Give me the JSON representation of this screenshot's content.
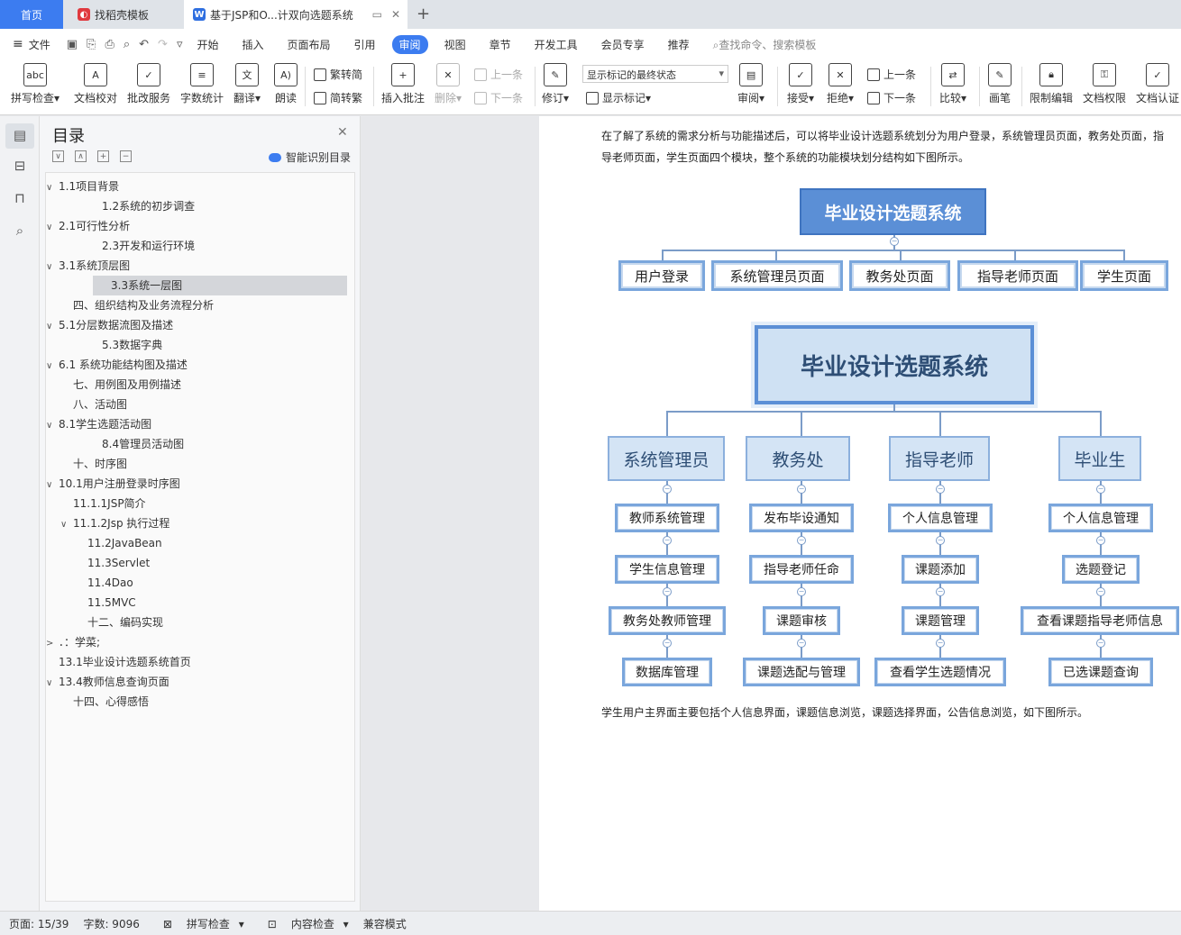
{
  "tabs": {
    "home": "首页",
    "template": "找稻壳模板",
    "doc": "基于JSP和O...计双向选题系统",
    "add": "+"
  },
  "menu": {
    "file": "文件",
    "items": [
      "开始",
      "插入",
      "页面布局",
      "引用",
      "审阅",
      "视图",
      "章节",
      "开发工具",
      "会员专享",
      "推荐"
    ],
    "active": "审阅",
    "search": "查找命令、搜索模板"
  },
  "ribbon": {
    "spell": "拼写检查",
    "proof": "文档校对",
    "revise_service": "批改服务",
    "wordcount": "字数统计",
    "translate": "翻译",
    "read": "朗读",
    "to_trad": "繁转简",
    "to_simp": "简转繁",
    "insert_comment": "插入批注",
    "delete": "删除",
    "prev": "上一条",
    "next": "下一条",
    "track": "修订",
    "markup_state": "显示标记的最终状态",
    "show_markup": "显示标记",
    "review": "审阅",
    "accept": "接受",
    "reject": "拒绝",
    "prev2": "上一条",
    "next2": "下一条",
    "compare": "比较",
    "pen": "画笔",
    "restrict": "限制编辑",
    "permission": "文档权限",
    "certify": "文档认证"
  },
  "toc": {
    "title": "目录",
    "smart": "智能识别目录",
    "items": [
      {
        "label": "1.1项目背景",
        "arrow": "∨"
      },
      {
        "label": "1.2系统的初步调查",
        "arrow": ""
      },
      {
        "label": "2.1可行性分析",
        "arrow": "∨"
      },
      {
        "label": "2.3开发和运行环境",
        "arrow": ""
      },
      {
        "label": "3.1系统顶层图",
        "arrow": "∨"
      },
      {
        "label": "3.3系统一层图",
        "arrow": ""
      },
      {
        "label": "四、组织结构及业务流程分析",
        "arrow": ""
      },
      {
        "label": "5.1分层数据流图及描述",
        "arrow": "∨"
      },
      {
        "label": "5.3数据字典",
        "arrow": ""
      },
      {
        "label": "6.1 系统功能结构图及描述",
        "arrow": "∨"
      },
      {
        "label": "七、用例图及用例描述",
        "arrow": ""
      },
      {
        "label": "八、活动图",
        "arrow": ""
      },
      {
        "label": "8.1学生选题活动图",
        "arrow": "∨"
      },
      {
        "label": "8.4管理员活动图",
        "arrow": ""
      },
      {
        "label": "十、时序图",
        "arrow": ""
      },
      {
        "label": "10.1用户注册登录时序图",
        "arrow": "∨"
      },
      {
        "label": "11.1.1JSP简介",
        "arrow": ""
      },
      {
        "label": "11.1.2Jsp 执行过程",
        "arrow": "∨"
      },
      {
        "label": "11.2JavaBean",
        "arrow": ""
      },
      {
        "label": "11.3Servlet",
        "arrow": ""
      },
      {
        "label": "11.4Dao",
        "arrow": ""
      },
      {
        "label": "11.5MVC",
        "arrow": ""
      },
      {
        "label": "十二、编码实现",
        "arrow": ""
      },
      {
        "label": "．：学菜;",
        "arrow": ">"
      },
      {
        "label": "13.1毕业设计选题系统首页",
        "arrow": ""
      },
      {
        "label": "13.4教师信息查询页面",
        "arrow": "∨"
      },
      {
        "label": "十四、心得感悟",
        "arrow": ""
      }
    ]
  },
  "doc": {
    "para1": "在了解了系统的需求分析与功能描述后，可以将毕业设计选题系统划分为用户登录，系统管理员页面，教务处页面，指导老师页面，学生页面四个模块，整个系统的功能模块划分结构如下图所示。",
    "chart1": {
      "root": "毕业设计选题系统",
      "nodes": [
        "用户登录",
        "系统管理员页面",
        "教务处页面",
        "指导老师页面",
        "学生页面"
      ]
    },
    "chart2": {
      "root": "毕业设计选题系统",
      "categories": [
        {
          "name": "系统管理员",
          "leaves": [
            "教师系统管理",
            "学生信息管理",
            "教务处教师管理",
            "数据库管理"
          ]
        },
        {
          "name": "教务处",
          "leaves": [
            "发布毕设通知",
            "指导老师任命",
            "课题审核",
            "课题选配与管理"
          ]
        },
        {
          "name": "指导老师",
          "leaves": [
            "个人信息管理",
            "课题添加",
            "课题管理",
            "查看学生选题情况"
          ]
        },
        {
          "name": "毕业生",
          "leaves": [
            "个人信息管理",
            "选题登记",
            "查看课题指导老师信息",
            "已选课题查询"
          ]
        }
      ]
    },
    "para2": "学生用户主界面主要包括个人信息界面，课题信息浏览，课题选择界面，公告信息浏览，如下图所示。"
  },
  "status": {
    "page": "页面: 15/39",
    "words": "字数: 9096",
    "spell": "拼写检查",
    "content": "内容检查",
    "compat": "兼容模式"
  }
}
